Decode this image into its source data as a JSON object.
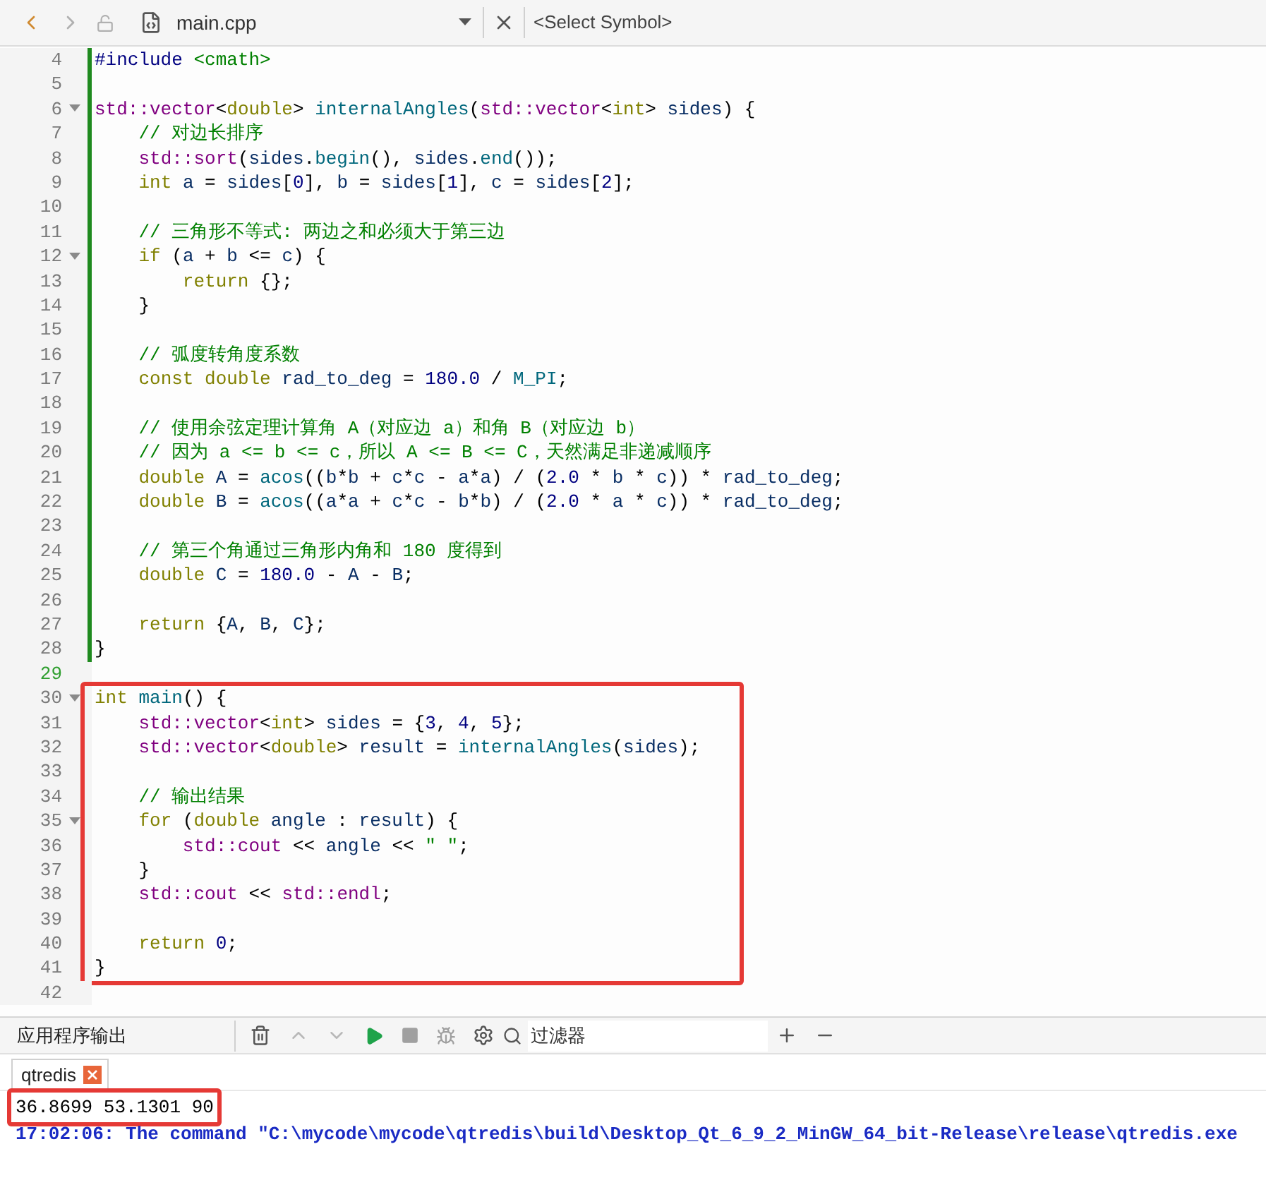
{
  "toolbar": {
    "back": {
      "disabled": false
    },
    "forward": {
      "disabled": true
    },
    "file_name": "main.cpp",
    "symbol_placeholder": "<Select Symbol>"
  },
  "editor": {
    "blocks": [
      {
        "changed": true,
        "current": false,
        "highlighted": false,
        "lines": [
          {
            "n": "4",
            "fold": false,
            "text": "#include <cmath>"
          },
          {
            "n": "5",
            "fold": false
          },
          {
            "n": "6",
            "fold": true,
            "text": "std::vector<double> internalAngles(std::vector<int> sides) {"
          },
          {
            "n": "7",
            "fold": false,
            "text": "    // 对边长排序"
          },
          {
            "n": "8",
            "fold": false,
            "text": "    std::sort(sides.begin(), sides.end());"
          },
          {
            "n": "9",
            "fold": false,
            "text": "    int a = sides[0], b = sides[1], c = sides[2];"
          },
          {
            "n": "10",
            "fold": false
          },
          {
            "n": "11",
            "fold": false,
            "text": "    // 三角形不等式: 两边之和必须大于第三边"
          },
          {
            "n": "12",
            "fold": true,
            "text": "    if (a + b <= c) {"
          },
          {
            "n": "13",
            "fold": false,
            "text": "        return {};"
          },
          {
            "n": "14",
            "fold": false,
            "text": "    }"
          },
          {
            "n": "15",
            "fold": false
          },
          {
            "n": "16",
            "fold": false,
            "text": "    // 弧度转角度系数"
          },
          {
            "n": "17",
            "fold": false,
            "text": "    const double rad_to_deg = 180.0 / M_PI;"
          },
          {
            "n": "18",
            "fold": false
          },
          {
            "n": "19",
            "fold": false,
            "text": "    // 使用余弦定理计算角 A（对应边 a）和角 B（对应边 b）"
          },
          {
            "n": "20",
            "fold": false,
            "text": "    // 因为 a <= b <= c，所以 A <= B <= C，天然满足非递减顺序"
          },
          {
            "n": "21",
            "fold": false,
            "text": "    double A = acos((b*b + c*c - a*a) / (2.0 * b * c)) * rad_to_deg;"
          },
          {
            "n": "22",
            "fold": false,
            "text": "    double B = acos((a*a + c*c - b*b) / (2.0 * a * c)) * rad_to_deg;"
          },
          {
            "n": "23",
            "fold": false
          },
          {
            "n": "24",
            "fold": false,
            "text": "    // 第三个角通过三角形内角和 180 度得到"
          },
          {
            "n": "25",
            "fold": false,
            "text": "    double C = 180.0 - A - B;"
          },
          {
            "n": "26",
            "fold": false
          },
          {
            "n": "27",
            "fold": false,
            "text": "    return {A, B, C};"
          },
          {
            "n": "28",
            "fold": false,
            "text": "}"
          }
        ]
      },
      {
        "changed": false,
        "current": true,
        "highlighted": false,
        "lines": [
          {
            "n": "29",
            "fold": false
          }
        ]
      },
      {
        "changed": false,
        "current": false,
        "highlighted": true,
        "lines": [
          {
            "n": "30",
            "fold": true,
            "text": "int main() {"
          },
          {
            "n": "31",
            "fold": false,
            "text": "    std::vector<int> sides = {3, 4, 5};"
          },
          {
            "n": "32",
            "fold": false,
            "text": "    std::vector<double> result = internalAngles(sides);"
          },
          {
            "n": "33",
            "fold": false
          },
          {
            "n": "34",
            "fold": false,
            "text": "    // 输出结果"
          },
          {
            "n": "35",
            "fold": true,
            "text": "    for (double angle : result) {"
          },
          {
            "n": "36",
            "fold": false,
            "text": "        std::cout << angle << \" \";"
          },
          {
            "n": "37",
            "fold": false,
            "text": "    }"
          },
          {
            "n": "38",
            "fold": false,
            "text": "    std::cout << std::endl;"
          },
          {
            "n": "39",
            "fold": false
          },
          {
            "n": "40",
            "fold": false,
            "text": "    return 0;"
          },
          {
            "n": "41",
            "fold": false,
            "text": "}"
          }
        ]
      },
      {
        "changed": false,
        "current": false,
        "highlighted": false,
        "lines": [
          {
            "n": "42",
            "fold": false
          }
        ]
      }
    ]
  },
  "output_panel": {
    "title": "应用程序输出",
    "filter_placeholder": "过滤器",
    "tabs": [
      {
        "label": "qtredis",
        "selected": true
      }
    ],
    "lines": [
      {
        "text": "36.8699 53.1301 90",
        "kind": "result",
        "highlighted": true
      },
      {
        "text": "17:02:06: The command \"C:\\mycode\\mycode\\qtredis\\build\\Desktop_Qt_6_9_2_MinGW_64_bit-Release\\release\\qtredis.exe",
        "kind": "message",
        "highlighted": false
      }
    ]
  }
}
